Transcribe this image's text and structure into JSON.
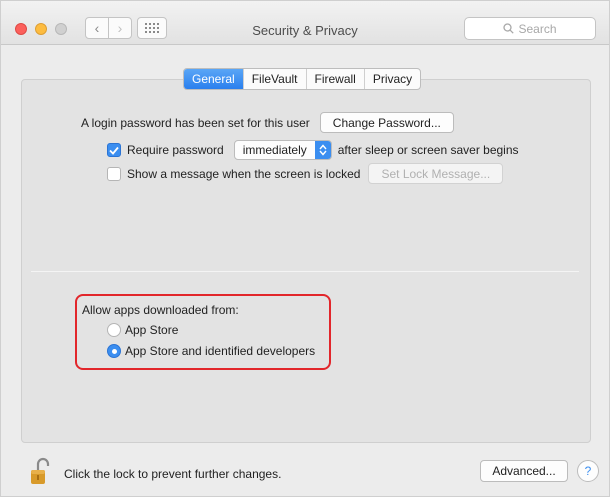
{
  "window": {
    "title": "Security & Privacy",
    "search_placeholder": "Search"
  },
  "tabs": [
    {
      "label": "General",
      "active": true
    },
    {
      "label": "FileVault",
      "active": false
    },
    {
      "label": "Firewall",
      "active": false
    },
    {
      "label": "Privacy",
      "active": false
    }
  ],
  "general": {
    "login_text": "A login password has been set for this user",
    "change_password_label": "Change Password...",
    "require_password_label": "Require password",
    "require_password_checked": true,
    "require_password_delay": "immediately",
    "after_sleep_text": "after sleep or screen saver begins",
    "show_message_label": "Show a message when the screen is locked",
    "show_message_checked": false,
    "set_lock_message_label": "Set Lock Message..."
  },
  "downloads": {
    "heading": "Allow apps downloaded from:",
    "options": [
      {
        "label": "App Store",
        "selected": false
      },
      {
        "label": "App Store and identified developers",
        "selected": true
      }
    ]
  },
  "footer": {
    "lock_text": "Click the lock to prevent further changes.",
    "advanced_label": "Advanced...",
    "help_label": "?"
  },
  "colors": {
    "accent": "#3b8ef0",
    "highlight_box": "#e2262b"
  }
}
